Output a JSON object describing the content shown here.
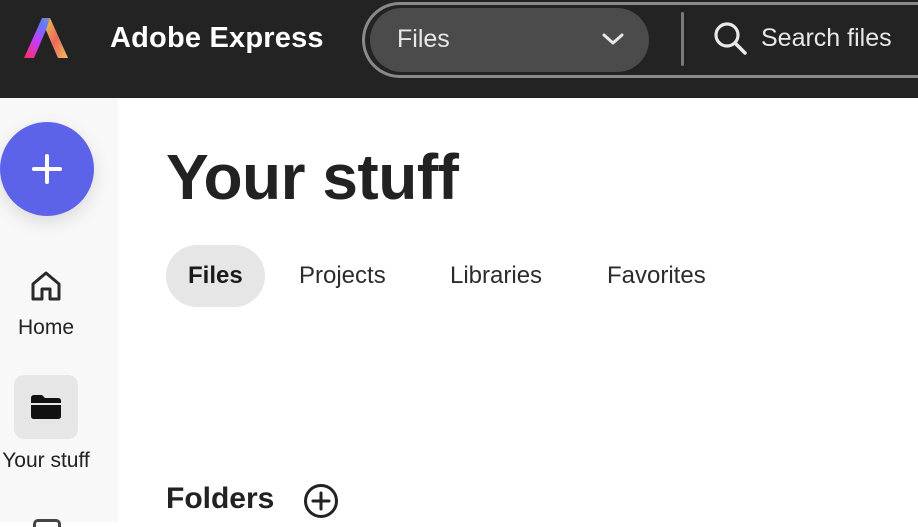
{
  "header": {
    "app_name": "Adobe Express",
    "scope_select": {
      "value": "Files",
      "icon": "chevron-down-icon"
    },
    "search": {
      "placeholder": "Search files",
      "icon": "search-icon"
    }
  },
  "sidebar": {
    "create_button": {
      "icon": "plus-icon",
      "color": "#5C63E8"
    },
    "items": [
      {
        "label": "Home",
        "icon": "home-icon",
        "active": false
      },
      {
        "label": "Your stuff",
        "icon": "folder-icon",
        "active": true
      }
    ]
  },
  "main": {
    "title": "Your stuff",
    "tabs": [
      {
        "label": "Files",
        "selected": true
      },
      {
        "label": "Projects",
        "selected": false
      },
      {
        "label": "Libraries",
        "selected": false
      },
      {
        "label": "Favorites",
        "selected": false
      }
    ],
    "folders_section": {
      "title": "Folders",
      "add_icon": "add-circle-icon"
    }
  },
  "colors": {
    "topbar": "#232323",
    "accent": "#5C63E8",
    "selected_tab": "#E6E6E6"
  }
}
